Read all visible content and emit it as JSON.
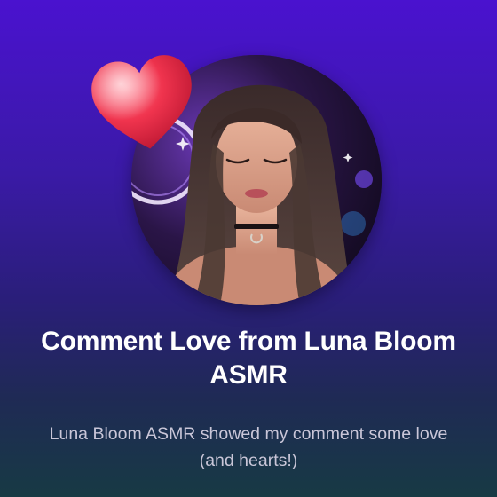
{
  "notification": {
    "title": "Comment Love from Luna Bloom ASMR",
    "message": "Luna Bloom ASMR showed my comment some love (and hearts!)"
  },
  "avatar": {
    "icon": "creator-avatar"
  },
  "badge": {
    "icon": "heart-icon",
    "color": "#f0344e"
  },
  "colors": {
    "background_top": "#4a12cf",
    "background_bottom": "#173a44",
    "title": "#ffffff",
    "message": "#c9c6d8"
  }
}
